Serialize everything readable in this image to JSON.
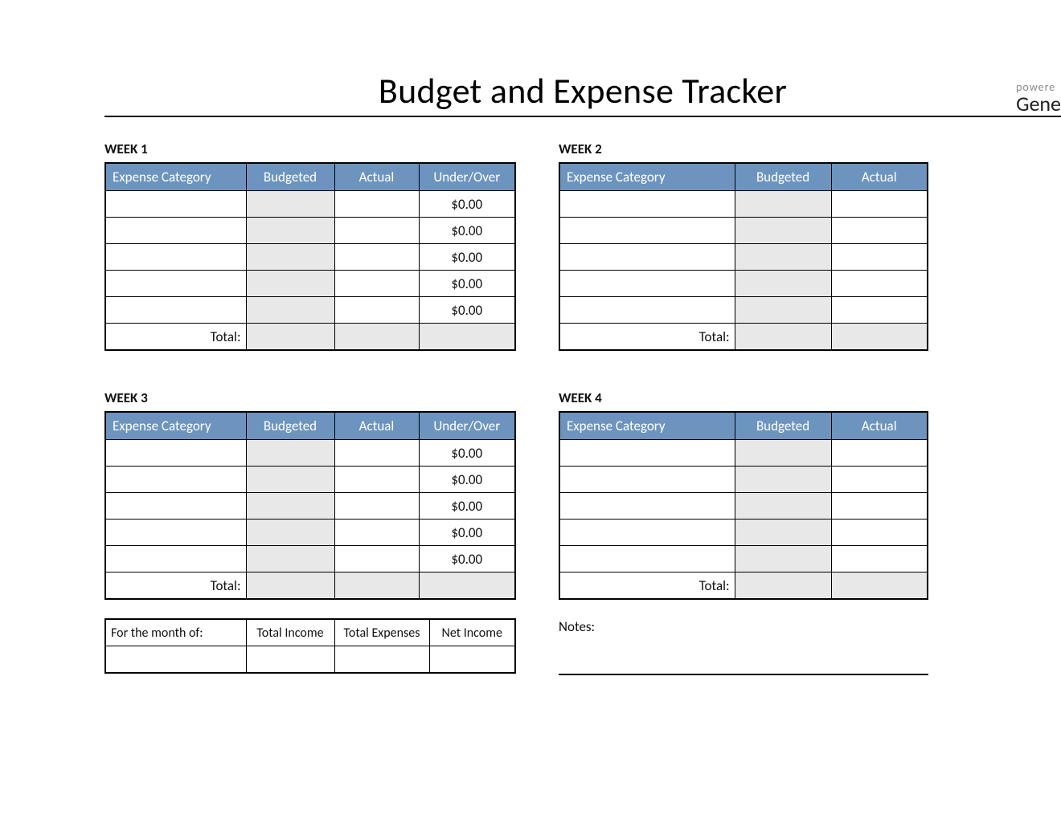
{
  "title": "Budget and Expense Tracker",
  "brand": {
    "powered": "powere",
    "name": "Gene"
  },
  "headers": {
    "category": "Expense Category",
    "budgeted": "Budgeted",
    "actual": "Actual",
    "underover": "Under/Over"
  },
  "weeks": [
    {
      "label": "WEEK 1",
      "variant": "A",
      "rows": [
        {
          "category": "",
          "budgeted": "",
          "actual": "",
          "underover": "$0.00"
        },
        {
          "category": "",
          "budgeted": "",
          "actual": "",
          "underover": "$0.00"
        },
        {
          "category": "",
          "budgeted": "",
          "actual": "",
          "underover": "$0.00"
        },
        {
          "category": "",
          "budgeted": "",
          "actual": "",
          "underover": "$0.00"
        },
        {
          "category": "",
          "budgeted": "",
          "actual": "",
          "underover": "$0.00"
        }
      ],
      "total_label": "Total:",
      "total": {
        "budgeted": "",
        "actual": "",
        "underover": ""
      }
    },
    {
      "label": "WEEK 2",
      "variant": "B",
      "rows": [
        {
          "category": "",
          "budgeted": "",
          "actual": ""
        },
        {
          "category": "",
          "budgeted": "",
          "actual": ""
        },
        {
          "category": "",
          "budgeted": "",
          "actual": ""
        },
        {
          "category": "",
          "budgeted": "",
          "actual": ""
        },
        {
          "category": "",
          "budgeted": "",
          "actual": ""
        }
      ],
      "total_label": "Total:",
      "total": {
        "budgeted": "",
        "actual": ""
      }
    },
    {
      "label": "WEEK 3",
      "variant": "A",
      "rows": [
        {
          "category": "",
          "budgeted": "",
          "actual": "",
          "underover": "$0.00"
        },
        {
          "category": "",
          "budgeted": "",
          "actual": "",
          "underover": "$0.00"
        },
        {
          "category": "",
          "budgeted": "",
          "actual": "",
          "underover": "$0.00"
        },
        {
          "category": "",
          "budgeted": "",
          "actual": "",
          "underover": "$0.00"
        },
        {
          "category": "",
          "budgeted": "",
          "actual": "",
          "underover": "$0.00"
        }
      ],
      "total_label": "Total:",
      "total": {
        "budgeted": "",
        "actual": "",
        "underover": ""
      }
    },
    {
      "label": "WEEK 4",
      "variant": "B",
      "rows": [
        {
          "category": "",
          "budgeted": "",
          "actual": ""
        },
        {
          "category": "",
          "budgeted": "",
          "actual": ""
        },
        {
          "category": "",
          "budgeted": "",
          "actual": ""
        },
        {
          "category": "",
          "budgeted": "",
          "actual": ""
        },
        {
          "category": "",
          "budgeted": "",
          "actual": ""
        }
      ],
      "total_label": "Total:",
      "total": {
        "budgeted": "",
        "actual": ""
      }
    }
  ],
  "summary": {
    "month_label": "For the month of:",
    "month_value": "",
    "total_income_label": "Total Income",
    "total_income_value": "",
    "total_expenses_label": "Total Expenses",
    "total_expenses_value": "",
    "net_income_label": "Net Income",
    "net_income_value": ""
  },
  "notes_label": "Notes:"
}
